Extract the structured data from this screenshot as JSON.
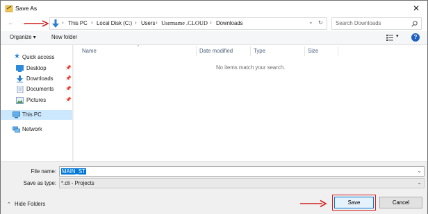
{
  "window": {
    "title": "Save As",
    "close_glyph": "✕"
  },
  "address": {
    "breadcrumbs": [
      "This PC",
      "Local Disk (C:)",
      "Users",
      "Username .CLOUD",
      "Downloads"
    ],
    "separator": "›",
    "dropdown_glyph": "⌄",
    "refresh_glyph": "↻"
  },
  "search": {
    "placeholder": "Search Downloads"
  },
  "toolbar": {
    "organize_label": "Organize ▾",
    "new_folder_label": "New folder"
  },
  "nav": {
    "items": [
      {
        "label": "Quick access",
        "icon": "star-icon"
      },
      {
        "label": "Desktop",
        "icon": "desktop-folder-icon",
        "pinned": true
      },
      {
        "label": "Downloads",
        "icon": "download-arrow-icon",
        "pinned": true
      },
      {
        "label": "Documents",
        "icon": "documents-icon",
        "pinned": true
      },
      {
        "label": "Pictures",
        "icon": "pictures-icon",
        "pinned": true
      },
      {
        "label": "This PC",
        "icon": "computer-icon",
        "selected": true
      },
      {
        "label": "Network",
        "icon": "network-icon"
      }
    ],
    "pin_glyph": "📌"
  },
  "filelist": {
    "columns": [
      "Name",
      "Date modified",
      "Type",
      "Size"
    ],
    "empty_message": "No items match your search."
  },
  "form": {
    "filename_label": "File name:",
    "filename_value": "MAIN_ST",
    "savetype_label": "Save as type:",
    "savetype_value": "*.cli - Projects"
  },
  "footer": {
    "hide_folders_label": "Hide Folders",
    "save_label": "Save",
    "cancel_label": "Cancel"
  },
  "colors": {
    "accent": "#0078d7",
    "annotation": "#d21f1f",
    "selected_bg": "#cce8ff"
  }
}
